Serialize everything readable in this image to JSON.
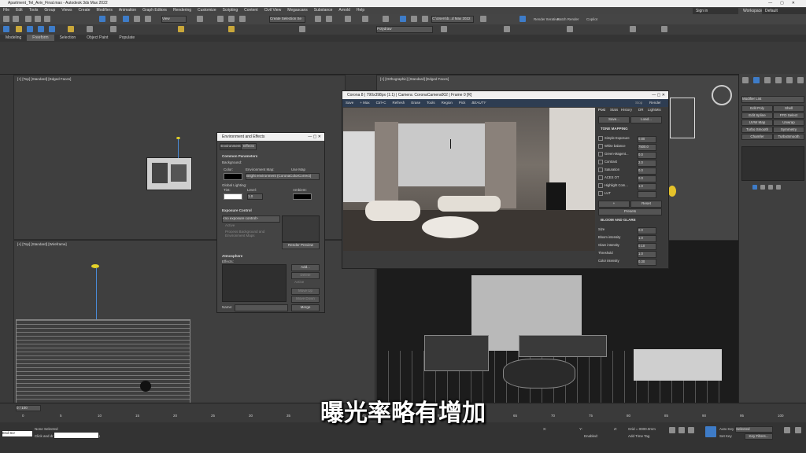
{
  "app": {
    "title": "Apartment_Tel_Aviv_Final.max - Autodesk 3ds Max 2022"
  },
  "menu": [
    "File",
    "Edit",
    "Tools",
    "Group",
    "Views",
    "Create",
    "Modifiers",
    "Animation",
    "Graph Editors",
    "Rendering",
    "Customize",
    "Scripting",
    "Content",
    "Civil View",
    "Megascans",
    "Substance",
    "Arnold",
    "Help"
  ],
  "account": {
    "user": "Sign in",
    "workspaces_label": "Workspaces:",
    "workspace": "Default"
  },
  "toolbar": {
    "view_dropdown": "View",
    "selection_set": "Create Selection Se",
    "render_setup_dropdown": "C:\\Users\\b...d Max 2022",
    "render_iterative": "Render Iterative",
    "batch_render": "Batch Render",
    "copilot": "Copilot"
  },
  "ribbon_tabs": [
    "Modeling",
    "Freeform",
    "Selection",
    "Object Paint",
    "Populate"
  ],
  "ribbon_active": "Freeform",
  "ribbon_dropdown": "Polydraw",
  "viewports": {
    "top_left": "[+] [Top] [Standard] [Edged Faces]",
    "top_right": "[+] [Orthographic] [Standard] [Edged Faces]",
    "bottom_left": "[+] [Top] [Standard] [Wireframe]"
  },
  "env_dialog": {
    "title": "Environment and Effects",
    "tabs": [
      "Environment",
      "Effects"
    ],
    "common_params": "Common Parameters",
    "background": "Background:",
    "color": "Color:",
    "env_map": "Environment Map:",
    "use_map": "Use Map",
    "env_map_value": "Bright environment (CoronaColorCorrect)",
    "global_lighting": "Global Lighting:",
    "tint": "Tint:",
    "level": "Level:",
    "level_value": "1.0",
    "ambient": "Ambient:",
    "exposure_control": "Exposure Control",
    "no_exposure": "<no exposure control>",
    "active": "Active",
    "process_bg": "Process Background and Environment Maps",
    "render_preview": "Render Preview",
    "atmosphere": "Atmosphere",
    "effects": "Effects:",
    "add": "Add...",
    "delete": "Delete",
    "active2": "Active",
    "move_up": "Move Up",
    "move_down": "Move Down",
    "name": "Name:",
    "merge": "Merge"
  },
  "vfb": {
    "title": "Corona 8 | 790x398px (1:1) | Camera: CoronaCamera002 | Frame 0 [R]",
    "toolbar": [
      "Save",
      "+ Max",
      "Ctrl+C",
      "Refresh",
      "Erase",
      "Tools",
      "Region",
      "Pick"
    ],
    "channel": "BEAUTY",
    "stop": "Stop",
    "render": "Render",
    "tabs": [
      "Post",
      "Stats",
      "History",
      "DR",
      "LightMix"
    ],
    "save": "Save...",
    "load": "Load...",
    "tone_mapping": "TONE MAPPING",
    "tm_rows": [
      {
        "label": "Simple Exposure",
        "value": "0.80"
      },
      {
        "label": "White balance",
        "value": "7500.0"
      },
      {
        "label": "Green-Magent...",
        "value": "0.0"
      },
      {
        "label": "Contrast",
        "value": "2.0"
      },
      {
        "label": "Saturation",
        "value": "0.0"
      },
      {
        "label": "ACES OT",
        "value": "0.0"
      },
      {
        "label": "Highlight Com...",
        "value": "1.0"
      },
      {
        "label": "LUT",
        "value": ""
      }
    ],
    "plus": "+",
    "reset": "Reset",
    "presets": "Presets",
    "bloom_glare": "BLOOM AND GLARE",
    "bloom_rows": [
      {
        "label": "Size",
        "value": "0.0"
      },
      {
        "label": "Bloom intensity",
        "value": "1.0"
      },
      {
        "label": "Glare intensity",
        "value": "0.10"
      },
      {
        "label": "Threshold",
        "value": "1.0"
      },
      {
        "label": "Color intensity",
        "value": "0.30"
      }
    ]
  },
  "command_panel": {
    "modifier_list": "Modifier List",
    "buttons": [
      "Edit Poly",
      "Shell",
      "Edit Spline",
      "FFD Select",
      "UVW Map",
      "Unwrap",
      "Turbo Smooth",
      "Symmetry",
      "Chamfer",
      "TurboSmooth",
      "Noise"
    ]
  },
  "timeline": {
    "frame": "0 / 100",
    "ticks": [
      "0",
      "5",
      "10",
      "15",
      "20",
      "25",
      "30",
      "35",
      "40",
      "45",
      "50",
      "55",
      "60",
      "65",
      "70",
      "75",
      "80",
      "85",
      "90",
      "95",
      "100"
    ]
  },
  "status": {
    "script_box": "End Scr",
    "selected": "None Selected",
    "hint": "Click and drag to select and move objects",
    "x": "X:",
    "y": "Y:",
    "z": "Z:",
    "grid": "Grid = 0000.0mm",
    "enabled": "Enabled:",
    "add_time_tag": "Add Time Tag",
    "auto_key": "Auto Key",
    "set_key": "Set Key",
    "selected_dd": "Selected",
    "key_filters": "Key Filters..."
  },
  "subtitle": "曝光率略有增加"
}
